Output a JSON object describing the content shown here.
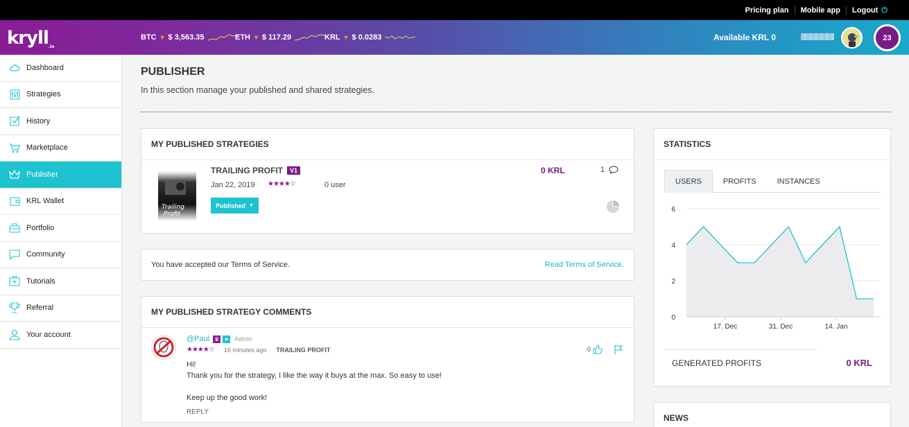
{
  "topbar": {
    "links": [
      "Pricing plan",
      "Mobile app",
      "Logout"
    ]
  },
  "header": {
    "logo": "kryll",
    "logo_sub": ".io",
    "tickers": [
      {
        "symbol": "BTC",
        "price": "$ 3,563.35"
      },
      {
        "symbol": "ETH",
        "price": "$ 117.29"
      },
      {
        "symbol": "KRL",
        "price": "$ 0.0283"
      }
    ],
    "available": "Available KRL 0",
    "level": "23",
    "colors": {
      "accent": "#1ec3cf",
      "brand": "#7a1a84",
      "ticker_down": "#f2a31a"
    }
  },
  "sidebar": {
    "items": [
      {
        "label": "Dashboard",
        "icon": "cloud-icon"
      },
      {
        "label": "Strategies",
        "icon": "sliders-icon"
      },
      {
        "label": "History",
        "icon": "checkbox-icon"
      },
      {
        "label": "Marketplace",
        "icon": "cart-icon"
      },
      {
        "label": "Publisher",
        "icon": "crown-icon"
      },
      {
        "label": "KRL Wallet",
        "icon": "wallet-icon"
      },
      {
        "label": "Portfolio",
        "icon": "briefcase-icon"
      },
      {
        "label": "Community",
        "icon": "chat-icon"
      },
      {
        "label": "Tutorials",
        "icon": "first-aid-icon"
      },
      {
        "label": "Referral",
        "icon": "trophy-icon"
      },
      {
        "label": "Your account",
        "icon": "user-icon"
      }
    ],
    "active": "Publisher"
  },
  "page": {
    "title": "PUBLISHER",
    "subtitle": "In this section manage your published and shared strategies."
  },
  "published": {
    "title": "MY PUBLISHED STRATEGIES",
    "strategy": {
      "name": "TRAILING PROFIT",
      "version": "V1",
      "date": "Jan 22, 2019",
      "rating": 4,
      "users": "0 user",
      "status": "Published",
      "price": "0 KRL",
      "comments": "1"
    }
  },
  "terms": {
    "text": "You have accepted our Terms of Service.",
    "link": "Read Terms of Service."
  },
  "comments": {
    "title": "MY PUBLISHED STRATEGY COMMENTS",
    "items": [
      {
        "user": "@Paul",
        "role": "Admin",
        "rating": 4,
        "when": "16 minutes ago",
        "strategy": "TRAILING PROFIT",
        "line1": "Hi!",
        "line2": "Thank you for the strategy, I like the way it buys at the max. So easy to use!",
        "line3": "Keep up the good work!",
        "reply": "REPLY",
        "likes": "0"
      }
    ]
  },
  "statistics": {
    "title": "STATISTICS",
    "tabs": [
      "USERS",
      "PROFITS",
      "INSTANCES"
    ],
    "active_tab": "USERS",
    "generated_label": "GENERATED PROFITS",
    "generated_value": "0 KRL"
  },
  "news": {
    "title": "NEWS"
  },
  "chart_data": {
    "type": "area",
    "x_tick_labels": [
      "17. Dec",
      "31. Dec",
      "14. Jan"
    ],
    "y_ticks": [
      0,
      2,
      4,
      6
    ],
    "ylim": [
      0,
      6
    ],
    "series": [
      {
        "values": [
          4,
          5,
          4,
          3,
          3,
          4,
          5,
          3,
          4,
          5,
          1,
          1
        ]
      }
    ],
    "color": "#1ec3cf",
    "fill": "#ececef"
  }
}
